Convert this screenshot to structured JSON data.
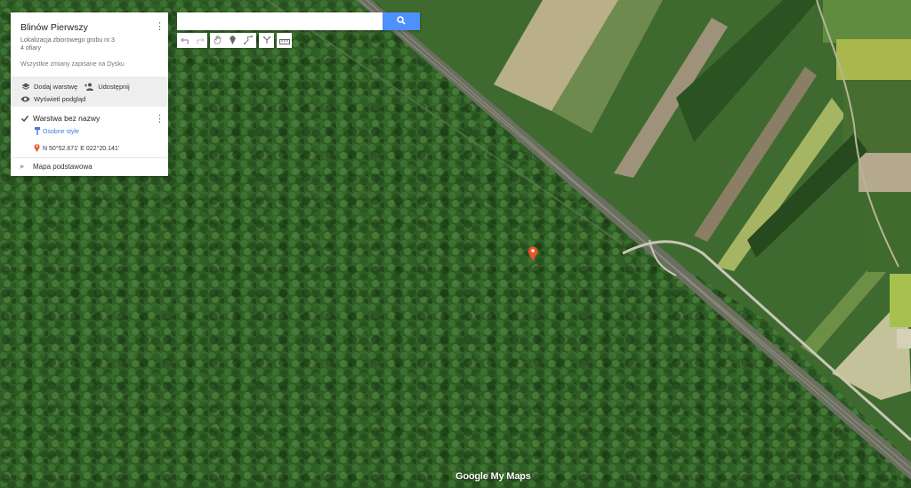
{
  "map": {
    "name": "Blinów Pierwszy",
    "description": "Lokalizacja zbiorowego grobu nr.3",
    "subdescription": "4 ofiary",
    "save_status": "Wszystkie zmiany zapisane na Dysku"
  },
  "actions": {
    "add_layer": "Dodaj warstwę",
    "share": "Udostępnij",
    "preview": "Wyświetl podgląd"
  },
  "layer": {
    "name": "Warstwa bez nazwy",
    "style_link": "Osobne style",
    "feature": "N 50°52.671' E 022°20.141'"
  },
  "basemap": {
    "label": "Mapa podstawowa"
  },
  "search": {
    "value": "",
    "placeholder": ""
  },
  "toolbar": {
    "tools": [
      "undo-icon",
      "redo-icon",
      "hand-icon",
      "marker-icon",
      "line-icon",
      "directions-icon",
      "ruler-icon"
    ]
  },
  "watermark": {
    "text": "Google My Maps"
  },
  "colors": {
    "accent": "#4d90fe",
    "marker": "#e8572a",
    "forest": "#2e5a24"
  }
}
